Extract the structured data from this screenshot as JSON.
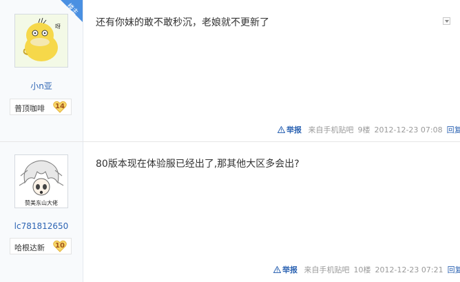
{
  "posts": [
    {
      "username": "小n亚",
      "role_tag": "楼主",
      "badge_name": "普顶咖啡",
      "badge_level": "14",
      "content": "还有你妹的敢不敢秒沉，老娘就不更新了",
      "report_label": "举报",
      "source": "来自手机贴吧",
      "floor": "9楼",
      "time": "2012-12-23 07:08",
      "reply_label": "回复"
    },
    {
      "username": "lc781812650",
      "avatar_caption": "赞美东山大佬",
      "badge_name": "哈根达新",
      "badge_level": "10",
      "content": "80版本现在体验服已经出了,那其他大区多会出?",
      "report_label": "举报",
      "source": "来自手机贴吧",
      "floor": "10楼",
      "time": "2012-12-23 07:21",
      "reply_label": "回复"
    }
  ],
  "colors": {
    "link": "#2d64b3",
    "meta": "#999999",
    "tag_bg": "#4a90e2",
    "sidebar_bg": "#f8fafc"
  }
}
